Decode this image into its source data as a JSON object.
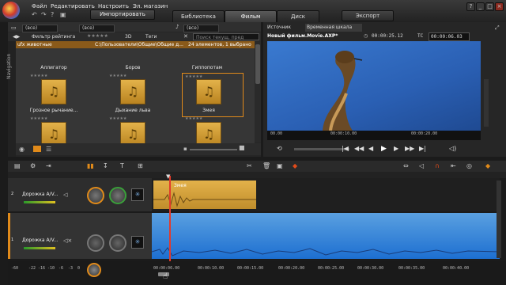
{
  "menu": [
    "Файл",
    "Редактировать",
    "Настроить",
    "Эл. магазин"
  ],
  "import_label": "Импортировать",
  "tabs": [
    "Библиотека",
    "Фильм",
    "Диск"
  ],
  "export_label": "Экспорт",
  "library": {
    "location1": "(все)",
    "location2": "(все)",
    "filter_label": "Фильтр рейтинга",
    "mode_3d": "3D",
    "tags_label": "Теги",
    "location3": "(все)",
    "search_placeholder": "Поиск текущ. пред",
    "nav_label": "Navigation",
    "collection": {
      "name": "ufx животные",
      "path": "C:\\Пользователи\\Общие\\Общие д...",
      "count": "24 элементов, 1 выбрано"
    },
    "items": [
      {
        "label": "Аллигатор"
      },
      {
        "label": "Боров"
      },
      {
        "label": "Гиппопотам"
      },
      {
        "label": "Грозное рычание..."
      },
      {
        "label": "Дыхание льва"
      },
      {
        "label": "Змея"
      },
      {
        "label": ""
      },
      {
        "label": ""
      },
      {
        "label": ""
      }
    ]
  },
  "preview": {
    "tab_source": "Источник",
    "tab_timeline": "Временная шкала",
    "project_name": "Новый фильм.Movie.AXP*",
    "duration": "00:00:25.12",
    "tc_label": "TC",
    "timecode": "00:00:06.03",
    "ruler": [
      "00.00",
      "00:00:10.00",
      "00:00:20.00"
    ]
  },
  "timeline": {
    "tracks": [
      {
        "number": "2",
        "name": "Дорожка A/V..."
      },
      {
        "number": "1",
        "name": "Дорожка A/V..."
      }
    ],
    "clip_label": "Змея",
    "bottom_scale": [
      "-60",
      "-22",
      "-16",
      "-10",
      "-6",
      "-3",
      "0"
    ],
    "bottom_times": [
      "00:00:06.00",
      "00:00:10.00",
      "00:00:15.00",
      "00:00:20.00",
      "00:00:25.00",
      "00:00:30.00",
      "00:00:35.00",
      "00:00:40.00"
    ]
  }
}
